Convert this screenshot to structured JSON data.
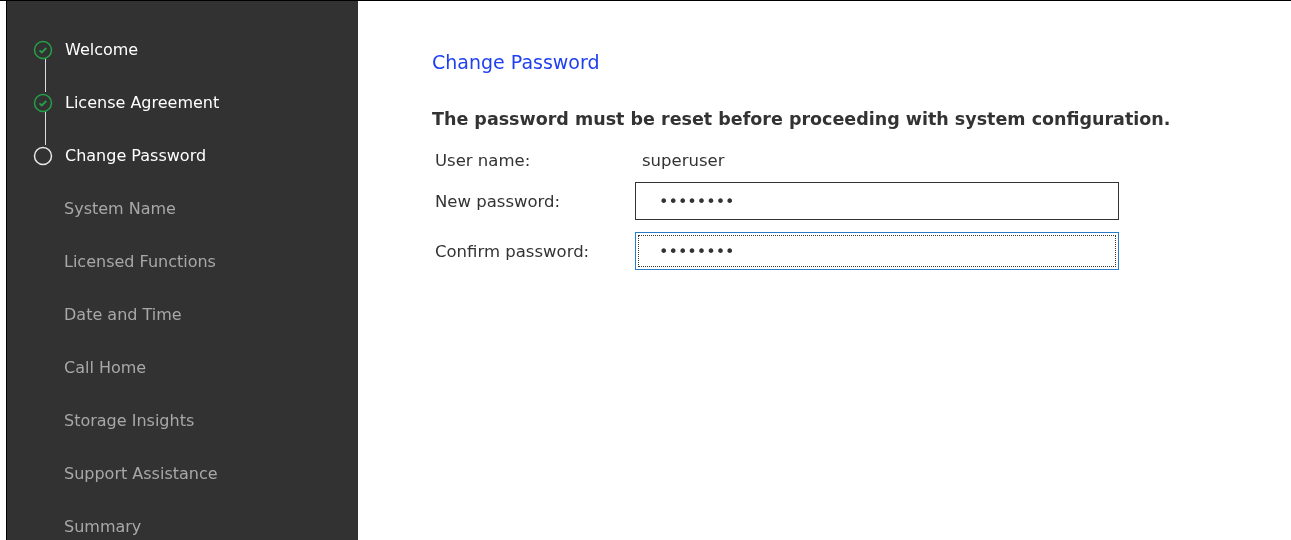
{
  "steps": [
    {
      "label": "Welcome",
      "kind": "done"
    },
    {
      "label": "License Agreement",
      "kind": "done"
    },
    {
      "label": "Change Password",
      "kind": "current"
    },
    {
      "label": "System Name",
      "kind": "pending"
    },
    {
      "label": "Licensed Functions",
      "kind": "pending"
    },
    {
      "label": "Date and Time",
      "kind": "pending"
    },
    {
      "label": "Call Home",
      "kind": "pending"
    },
    {
      "label": "Storage Insights",
      "kind": "pending"
    },
    {
      "label": "Support Assistance",
      "kind": "pending"
    },
    {
      "label": "Summary",
      "kind": "pending"
    }
  ],
  "page_title": "Change Password",
  "notice": "The password must be reset before proceeding with system configuration.",
  "fields": [
    {
      "label": "User name:",
      "kind": "text",
      "value": "superuser"
    },
    {
      "label": "New password:",
      "kind": "input",
      "value": "••••••••",
      "focused": false
    },
    {
      "label": "Confirm password:",
      "kind": "input",
      "value": "••••••••",
      "focused": true
    }
  ]
}
